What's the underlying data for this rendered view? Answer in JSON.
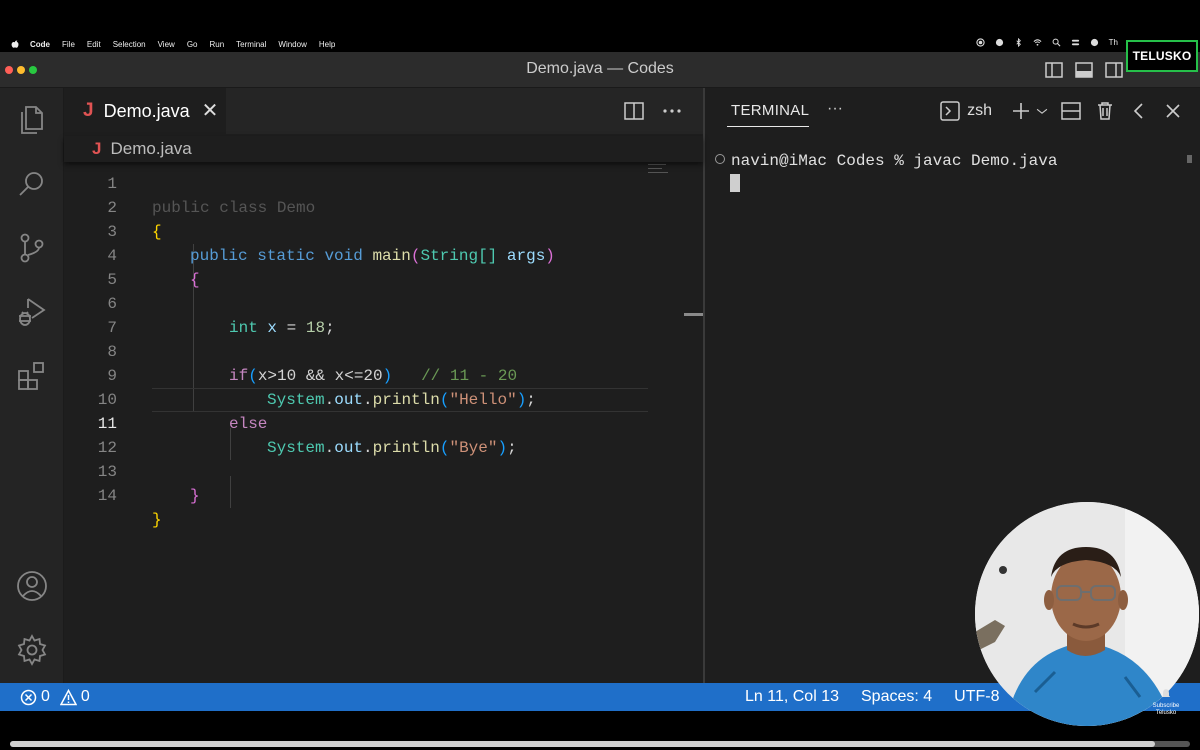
{
  "menubar": {
    "items": [
      "Code",
      "File",
      "Edit",
      "Selection",
      "View",
      "Go",
      "Run",
      "Terminal",
      "Window",
      "Help"
    ],
    "clipped_text": "Th"
  },
  "window": {
    "title": "Demo.java — Codes",
    "logo_text": "TELUSKO"
  },
  "activity_bar": {
    "icons": [
      "explorer-icon",
      "search-icon",
      "source-control-icon",
      "run-debug-icon",
      "extensions-icon",
      "account-icon",
      "settings-gear-icon"
    ]
  },
  "editor": {
    "tab": {
      "icon": "J",
      "label": "Demo.java",
      "close": "✕"
    },
    "breadcrumb": {
      "icon": "J",
      "label": "Demo.java"
    },
    "line_numbers": [
      "1",
      "2",
      "3",
      "4",
      "5",
      "6",
      "7",
      "8",
      "9",
      "10",
      "11",
      "12",
      "13",
      "14"
    ],
    "active_line": 11,
    "partial_line_1": "public class Demo",
    "code_tokens": {
      "l2_open": "{",
      "l3": [
        "public",
        "static",
        "void",
        "main",
        "(",
        "String[]",
        "args",
        ")"
      ],
      "l4_open": "{",
      "l6": [
        "int",
        "x",
        "=",
        "18",
        ";"
      ],
      "l8": [
        "if",
        "(",
        "x>10 && x<=20",
        ")",
        "// 11 - 20"
      ],
      "l9": [
        "System",
        ".",
        "out",
        ".",
        "println",
        "(",
        "\"Hello\"",
        ")",
        ";"
      ],
      "l10": [
        "else"
      ],
      "l11": [
        "System",
        ".",
        "out",
        ".",
        "println",
        "(",
        "\"Bye\"",
        ")",
        ";"
      ],
      "l13_close": "}",
      "l14_close": "}"
    }
  },
  "terminal": {
    "tab_label": "TERMINAL",
    "more": "···",
    "shell": "zsh",
    "prompt_line": "navin@iMac Codes % javac Demo.java"
  },
  "statusbar": {
    "errors": "0",
    "warnings": "0",
    "position": "Ln 11, Col 13",
    "spaces": "Spaces: 4",
    "encoding": "UTF-8"
  },
  "overlay": {
    "subscribe_line1": "Subscribe",
    "subscribe_line2": "Telusko"
  },
  "video": {
    "progress": 0.97
  }
}
